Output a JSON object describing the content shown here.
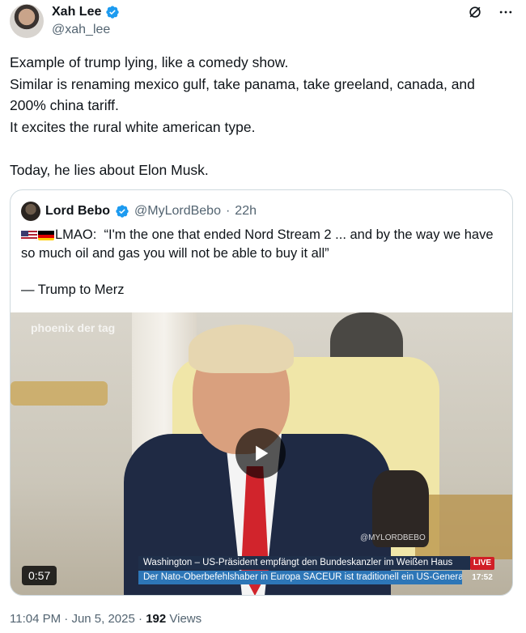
{
  "tweet": {
    "author_name": "Xah Lee",
    "author_handle": "@xah_lee",
    "text": "Example of trump lying, like a comedy show.\nSimilar is renaming mexico gulf, take panama, take greeland, canada, and 200% china tariff.\nIt excites the rural white american type.\n\nToday, he lies about Elon Musk.",
    "time": "11:04 PM",
    "date": "Jun 5, 2025",
    "views_count": "192",
    "views_label": "Views"
  },
  "quote": {
    "author_name": "Lord Bebo",
    "author_handle": "@MyLordBebo",
    "age": "22h",
    "text": "LMAO:  “I'm the one that ended Nord Stream 2 ... and by the way we have so much oil and gas you will not be able to buy it all”\n\n— Trump to Merz",
    "video": {
      "duration": "0:57",
      "channel_watermark": "phoenix der tag",
      "overlay_watermark": "@MYLORDBEBO",
      "ticker_headline": "Washington – US-Präsident empfängt den Bundeskanzler im Weißen Haus",
      "ticker_subline": "Der Nato-Oberbefehlshaber in Europa SACEUR ist traditionell ein US-General",
      "live_label": "LIVE",
      "clock": "17:52"
    }
  },
  "icons": {
    "grok": "grok-icon",
    "more": "more-icon",
    "verified": "verified-icon",
    "play": "play-icon",
    "flags": [
      "us-flag-icon",
      "germany-flag-icon"
    ]
  },
  "colors": {
    "verified_blue": "#1d9bf0",
    "muted_text": "#536471",
    "border": "#cfd9de",
    "live_red": "#d11f27"
  }
}
